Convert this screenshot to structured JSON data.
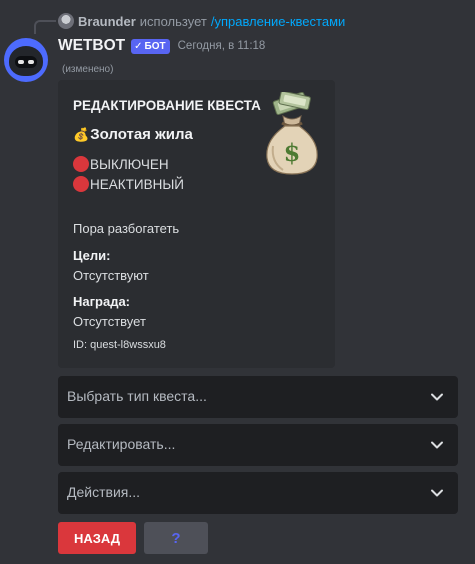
{
  "reply": {
    "user": "Braunder",
    "verb": "использует",
    "command": "/управление-квестами"
  },
  "message": {
    "author": "WETBOT",
    "bot_tag": "БОТ",
    "bot_tag_check": "✓",
    "timestamp": "Сегодня, в 11:18",
    "edited": "(изменено)"
  },
  "embed": {
    "title": "РЕДАКТИРОВАНИЕ КВЕСТА",
    "quest_emoji": "💰",
    "quest_name": "Золотая жила",
    "status_1": "ВЫКЛЮЧЕН",
    "status_2": "НЕАКТИВНЫЙ",
    "description": "Пора разбогатеть",
    "fields": [
      {
        "name": "Цели:",
        "value": "Отсутствуют"
      },
      {
        "name": "Награда:",
        "value": "Отсутствует"
      }
    ],
    "footer": "ID: quest-l8wssxu8",
    "thumbnail_icon": "money-bag-icon"
  },
  "selects": [
    {
      "placeholder": "Выбрать тип квеста..."
    },
    {
      "placeholder": "Редактировать..."
    },
    {
      "placeholder": "Действия..."
    }
  ],
  "buttons": {
    "back_label": "НАЗАД",
    "help_label": "?"
  },
  "colors": {
    "background": "#313338",
    "embed_bg": "#2b2d31",
    "select_bg": "#1e1f22",
    "danger": "#da373c",
    "secondary": "#4e5058",
    "blurple": "#5865f2",
    "link": "#00a8fc"
  }
}
